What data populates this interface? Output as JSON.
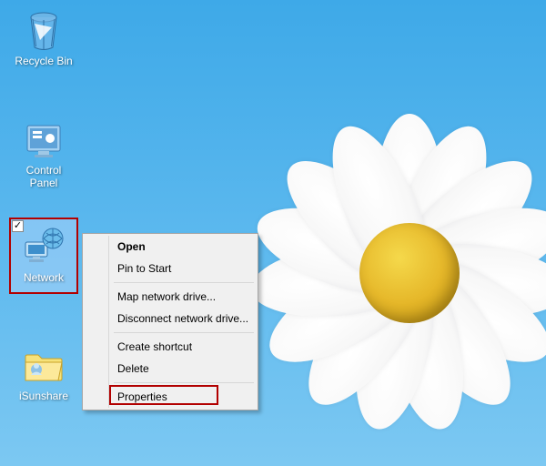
{
  "desktop": {
    "icons": [
      {
        "name": "recycle-bin",
        "label": "Recycle Bin"
      },
      {
        "name": "control-panel",
        "label": "Control\nPanel"
      },
      {
        "name": "network",
        "label": "Network"
      },
      {
        "name": "isunshare-folder",
        "label": "iSunshare"
      }
    ]
  },
  "selection": {
    "icon": "network",
    "checked": true
  },
  "context_menu": {
    "items": [
      {
        "label": "Open",
        "bold": true
      },
      {
        "label": "Pin to Start"
      },
      {
        "separator": true
      },
      {
        "label": "Map network drive..."
      },
      {
        "label": "Disconnect network drive..."
      },
      {
        "separator": true
      },
      {
        "label": "Create shortcut"
      },
      {
        "label": "Delete",
        "highlighted": true
      },
      {
        "separator": true
      },
      {
        "label": "Properties"
      }
    ]
  }
}
